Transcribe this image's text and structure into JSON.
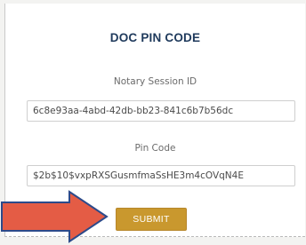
{
  "form": {
    "title": "DOC PIN CODE",
    "session_label": "Notary Session ID",
    "session_value": "6c8e93aa-4abd-42db-bb23-841c6b7b56dc",
    "pin_label": "Pin Code",
    "pin_value": "$2b$10$vxpRXSGusmfmaSsHE3m4cOVqN4E",
    "submit_label": "SUBMIT"
  },
  "colors": {
    "title": "#1f3a5c",
    "submit_bg": "#c9982e",
    "arrow_fill": "#e45c45",
    "arrow_stroke": "#2c4a8a"
  },
  "icons": {
    "pointer": "arrow-right-icon"
  }
}
